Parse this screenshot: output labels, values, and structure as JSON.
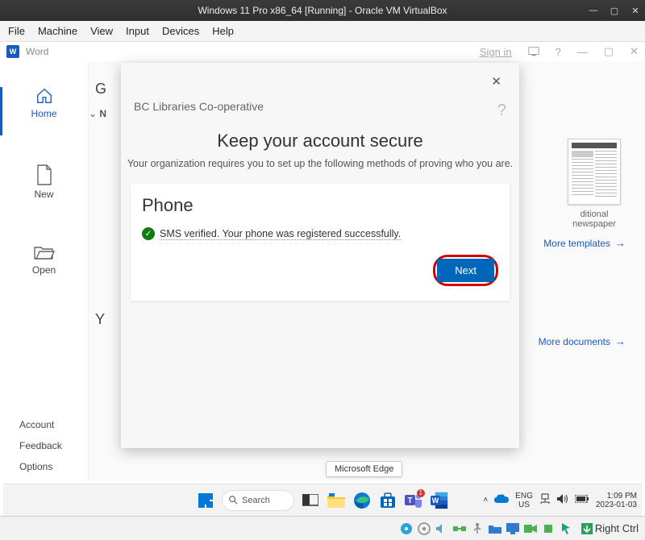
{
  "vbox": {
    "title": "Windows 11 Pro x86_64 [Running] - Oracle VM VirtualBox",
    "menu": {
      "file": "File",
      "machine": "Machine",
      "view": "View",
      "input": "Input",
      "devices": "Devices",
      "help": "Help"
    },
    "hostkey": "Right Ctrl"
  },
  "word": {
    "app_name": "Word",
    "signin": "Sign in",
    "sidebar": {
      "home": "Home",
      "new": "New",
      "open": "Open",
      "account": "Account",
      "feedback": "Feedback",
      "options": "Options"
    },
    "main": {
      "partial_g": "G",
      "chevron_n": "N",
      "partial_y": "Y",
      "template_label": "ditional newspaper",
      "more_templates": "More templates",
      "more_documents": "More documents"
    }
  },
  "modal": {
    "org": "BC Libraries Co-operative",
    "help": "?",
    "title": "Keep your account secure",
    "subtitle": "Your organization requires you to set up the following methods of proving who you are.",
    "section": "Phone",
    "status": "SMS verified. Your phone was registered successfully.",
    "next": "Next"
  },
  "tooltip": {
    "edge": "Microsoft Edge"
  },
  "taskbar": {
    "search": "Search",
    "lang1": "ENG",
    "lang2": "US",
    "time": "1:09 PM",
    "date": "2023-01-03",
    "teams_badge": "1"
  }
}
